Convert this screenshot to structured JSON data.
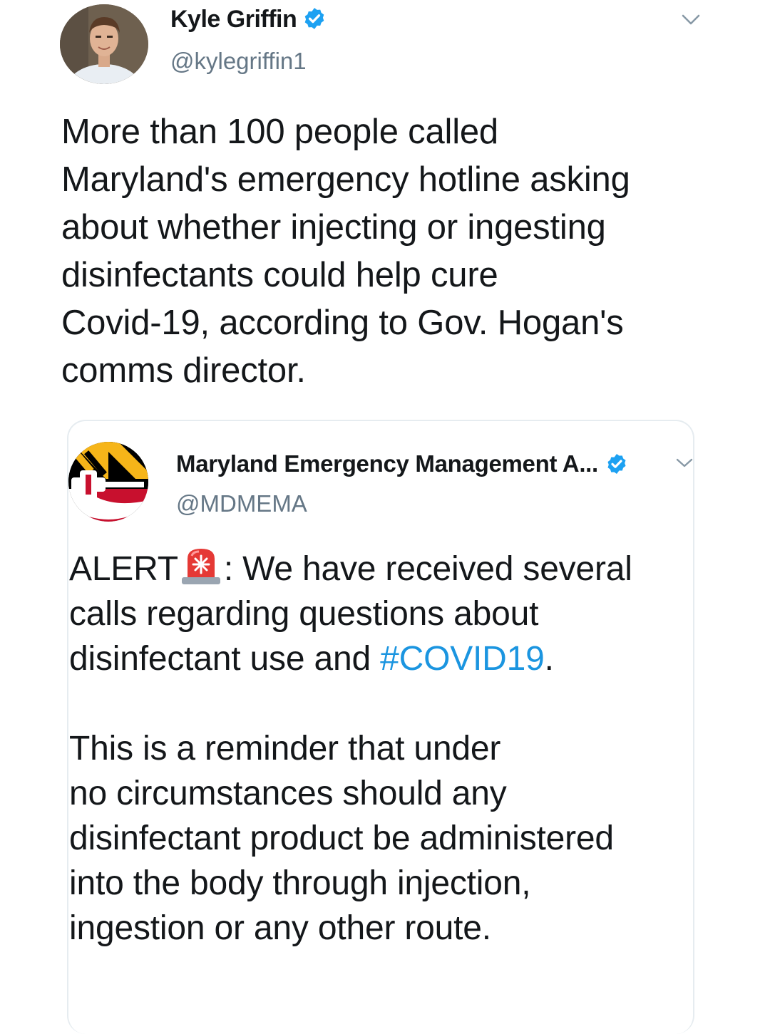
{
  "tweet": {
    "author": {
      "name": "Kyle Griffin",
      "handle": "@kylegriffin1",
      "verified": true,
      "avatar_icon": "user-avatar-photo"
    },
    "text_lines": [
      "More than 100 people called",
      "Maryland's emergency hotline asking",
      "about whether injecting or ingesting",
      "disinfectants could help cure",
      "Covid-19, according to Gov. Hogan's",
      "comms director."
    ]
  },
  "quoted_tweet": {
    "author": {
      "name": "Maryland Emergency Management A...",
      "handle": "@MDMEMA",
      "verified": true,
      "avatar_icon": "maryland-flag-logo"
    },
    "line1_prefix": "ALERT",
    "line1_suffix": ": We have received several",
    "line2": "calls regarding questions about",
    "line3_prefix": "disinfectant use and ",
    "hashtag": "#COVID19",
    "line3_suffix": ".",
    "paragraph2_lines": [
      "This is a reminder that under",
      "no circumstances should any",
      "disinfectant product be administered",
      "into the body through injection,",
      "ingestion or any other route."
    ]
  },
  "colors": {
    "verified_blue": "#1da1f2",
    "hashtag_blue": "#1b95e0",
    "handle_gray": "#657786",
    "text": "#14171a",
    "divider": "#e6ecf0"
  }
}
